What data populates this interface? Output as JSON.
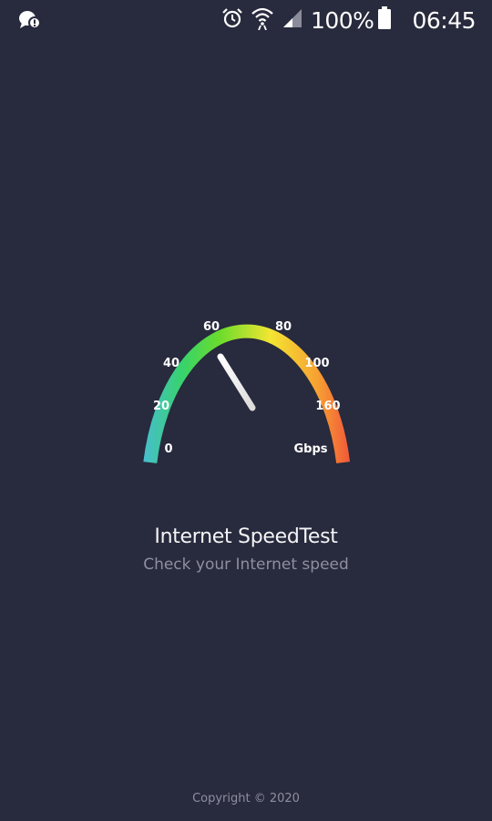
{
  "status_bar": {
    "battery_percent": "100%",
    "time": "06:45",
    "icons": [
      "chat-bubble-icon",
      "alarm-clock-icon",
      "wifi-icon",
      "signal-icon",
      "battery-icon"
    ]
  },
  "gauge": {
    "tick_labels": [
      "0",
      "20",
      "40",
      "60",
      "80",
      "100",
      "160"
    ],
    "unit_label": "Gbps",
    "colors": [
      "#4cb8ea",
      "#37d36b",
      "#6bdc2c",
      "#f3e532",
      "#f7a232",
      "#ee3c3c"
    ],
    "needle_color": "#ffffff"
  },
  "title": "Internet SpeedTest",
  "subtitle": "Check your Internet speed",
  "copyright": "Copyright © 2020",
  "theme": {
    "background": "#282a3d",
    "text_primary": "#f4f4f6",
    "text_secondary": "#8e90a1"
  }
}
